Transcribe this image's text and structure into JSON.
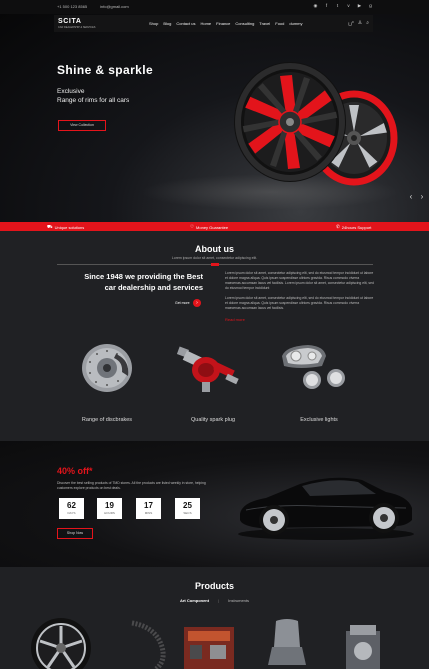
{
  "topbar": {
    "phone": "+1 500 123 8565",
    "email": "info@gmail.com",
    "social_icons": [
      "rss-icon",
      "facebook-icon",
      "twitter-icon",
      "vimeo-icon",
      "youtube-icon",
      "google-plus-icon"
    ]
  },
  "header": {
    "logo": "SCITA",
    "logo_tagline": "CAR DEALERSHIP & SERVICES",
    "nav": [
      "Shop",
      "Blog",
      "Contact us",
      "Home",
      "Finance",
      "Consulting",
      "Travel",
      "Food",
      "dummy"
    ],
    "cart_count": "0"
  },
  "hero": {
    "title": "Shine & sparkle",
    "subtitle_line1": "Exclusive",
    "subtitle_line2": "Range of rims for all cars",
    "button": "View Collection"
  },
  "features": [
    {
      "icon": "car-icon",
      "label": "Unique solutions"
    },
    {
      "icon": "heart-icon",
      "label": "Money Guarantee"
    },
    {
      "icon": "phone-icon",
      "label": "24hours Support"
    }
  ],
  "about": {
    "title": "About us",
    "subtitle": "Lorem ipsum dolor sit amet, consectetur adipiscing elit.",
    "heading_line1": "Since 1948 we providing the Best",
    "heading_line2": "car dealership and services",
    "get_more": "Get more",
    "para1": "Lorem ipsum dolor sit amet, consectetur adipiscing elit, sed do eiusmod tempor incididunt ut labore et dolore magna aliqua. Quis ipsum suspendisse ultrices gravida. Risus commodo viverra maecenas accumsan lacus vel facilisis. Lorem ipsum dolor sit amet, consectetur adipiscing elit, sed do eiusmod tempor incididunt",
    "para2": "Lorem ipsum dolor sit amet, consectetur adipiscing elit, sed do eiusmod tempor incididunt ut labore et dolore magna aliqua. Quis ipsum suspendisse ultrices gravida. Risus commodo viverra maecenas accumsan lacus vel facilisis.",
    "read_more": "Read more"
  },
  "highlights": [
    {
      "icon": "disc-brake-icon",
      "label": "Range of discbrakes"
    },
    {
      "icon": "spark-plug-icon",
      "label": "Quality spark plug"
    },
    {
      "icon": "headlight-icon",
      "label": "Exclusive lights"
    }
  ],
  "offer": {
    "percent": "40% off*",
    "text": "Discover the best selling products of TMD stores. All the products are listed weekly in store, helping customers explore products on best deals.",
    "countdown": [
      {
        "value": "62",
        "label": "DAYS"
      },
      {
        "value": "19",
        "label": "HOURS"
      },
      {
        "value": "17",
        "label": "MINS"
      },
      {
        "value": "25",
        "label": "SECS"
      }
    ],
    "button": "Shop Now"
  },
  "products": {
    "title": "Products",
    "tabs": [
      "Art Component",
      "Instruments"
    ]
  }
}
